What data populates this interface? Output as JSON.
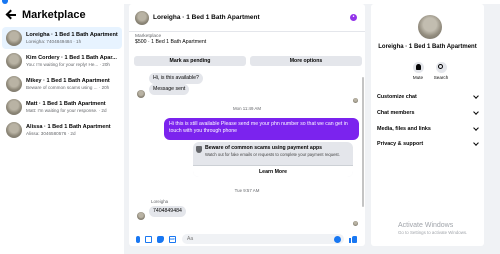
{
  "left": {
    "title": "Marketplace",
    "conversations": [
      {
        "name": "Loreigha · 1 Bed 1 Bath Apartment",
        "snippet": "Loreigha: 7404849484 · 1h"
      },
      {
        "name": "Kim Cordery · 1 Bed 1 Bath Apar...",
        "snippet": "You: I'm waiting for your reply! He... · 20h"
      },
      {
        "name": "Mikey · 1 Bed 1 Bath Apartment",
        "snippet": "Beware of common scams using ... · 20h"
      },
      {
        "name": "Matt · 1 Bed 1 Bath Apartment",
        "snippet": "Matt: I'm waiting for your response. · 2d"
      },
      {
        "name": "Alissa · 1 Bed 1 Bath Apartment",
        "snippet": "Alissa: 3046580576 · 2d"
      }
    ]
  },
  "chat": {
    "title": "Loreigha · 1 Bed 1 Bath Apartment",
    "listing_label": "Marketplace",
    "listing_price": "$500 · 1 Bed 1 Bath Apartment",
    "mark_pending": "Mark as pending",
    "more_options": "More options",
    "msg_in_1": "Hi, is this available?",
    "msg_in_2": "Message sent",
    "timestamp_1": "Mon 11:49 AM",
    "msg_out": "Hi this is still available Please send me your phn number so that we can get in touch with you through phone",
    "warning_title": "Beware of common scams using payment apps",
    "warning_body": "Watch out for fake emails or requests to complete your payment request.",
    "learn_more": "Learn More",
    "timestamp_2": "Tue 9:57 AM",
    "sender_name": "Loreigha",
    "msg_in_3": "7404849484",
    "input_placeholder": "Aa"
  },
  "right": {
    "name": "Loreigha · 1 Bed 1 Bath Apartment",
    "mute": "Mute",
    "search": "Search",
    "sections": [
      "Customize chat",
      "Chat members",
      "Media, files and links",
      "Privacy & support"
    ]
  },
  "watermark": {
    "title": "Activate Windows",
    "subtitle": "Go to Settings to activate Windows."
  },
  "colors": {
    "accent": "#1877f2",
    "outgoing_bubble": "#7b23ee"
  },
  "icons": [
    "back-arrow-icon",
    "info-icon",
    "shield-icon",
    "mic-icon",
    "photo-icon",
    "sticker-icon",
    "gif-icon",
    "emoji-icon",
    "like-icon",
    "bell-icon",
    "search-icon",
    "chevron-down-icon"
  ]
}
